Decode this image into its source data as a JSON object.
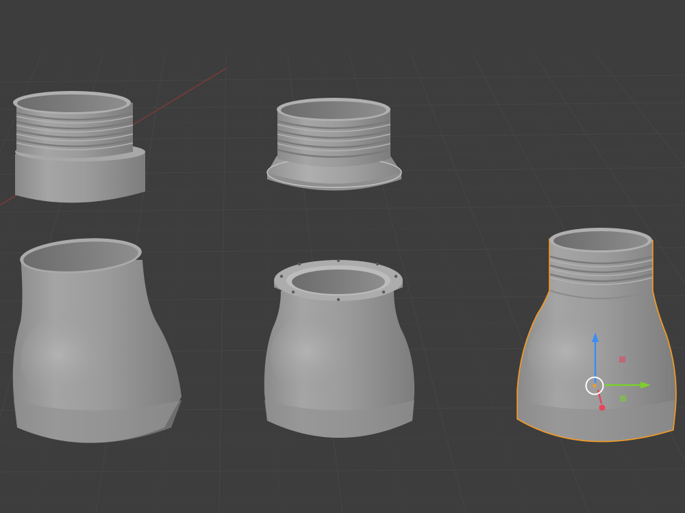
{
  "viewport": {
    "background_color": "#3d3d3d",
    "grid_line_color": "#4a4a4a",
    "x_axis_color": "#8c3a3a"
  },
  "objects": [
    {
      "name": "threaded-connector",
      "selected": false
    },
    {
      "name": "threaded-flange-connector",
      "selected": false
    },
    {
      "name": "plain-reducer",
      "selected": false
    },
    {
      "name": "flanged-reducer",
      "selected": false
    },
    {
      "name": "threaded-reducer",
      "selected": true
    }
  ],
  "colors": {
    "mesh_gray": "#9a9a9a",
    "selection_outline": "#f29b25",
    "gizmo_x": "#e8445a",
    "gizmo_y": "#7ccf2e",
    "gizmo_z": "#3a8ef6"
  },
  "gizmo": {
    "type": "transform-move",
    "axes": [
      "x",
      "y",
      "z"
    ]
  }
}
